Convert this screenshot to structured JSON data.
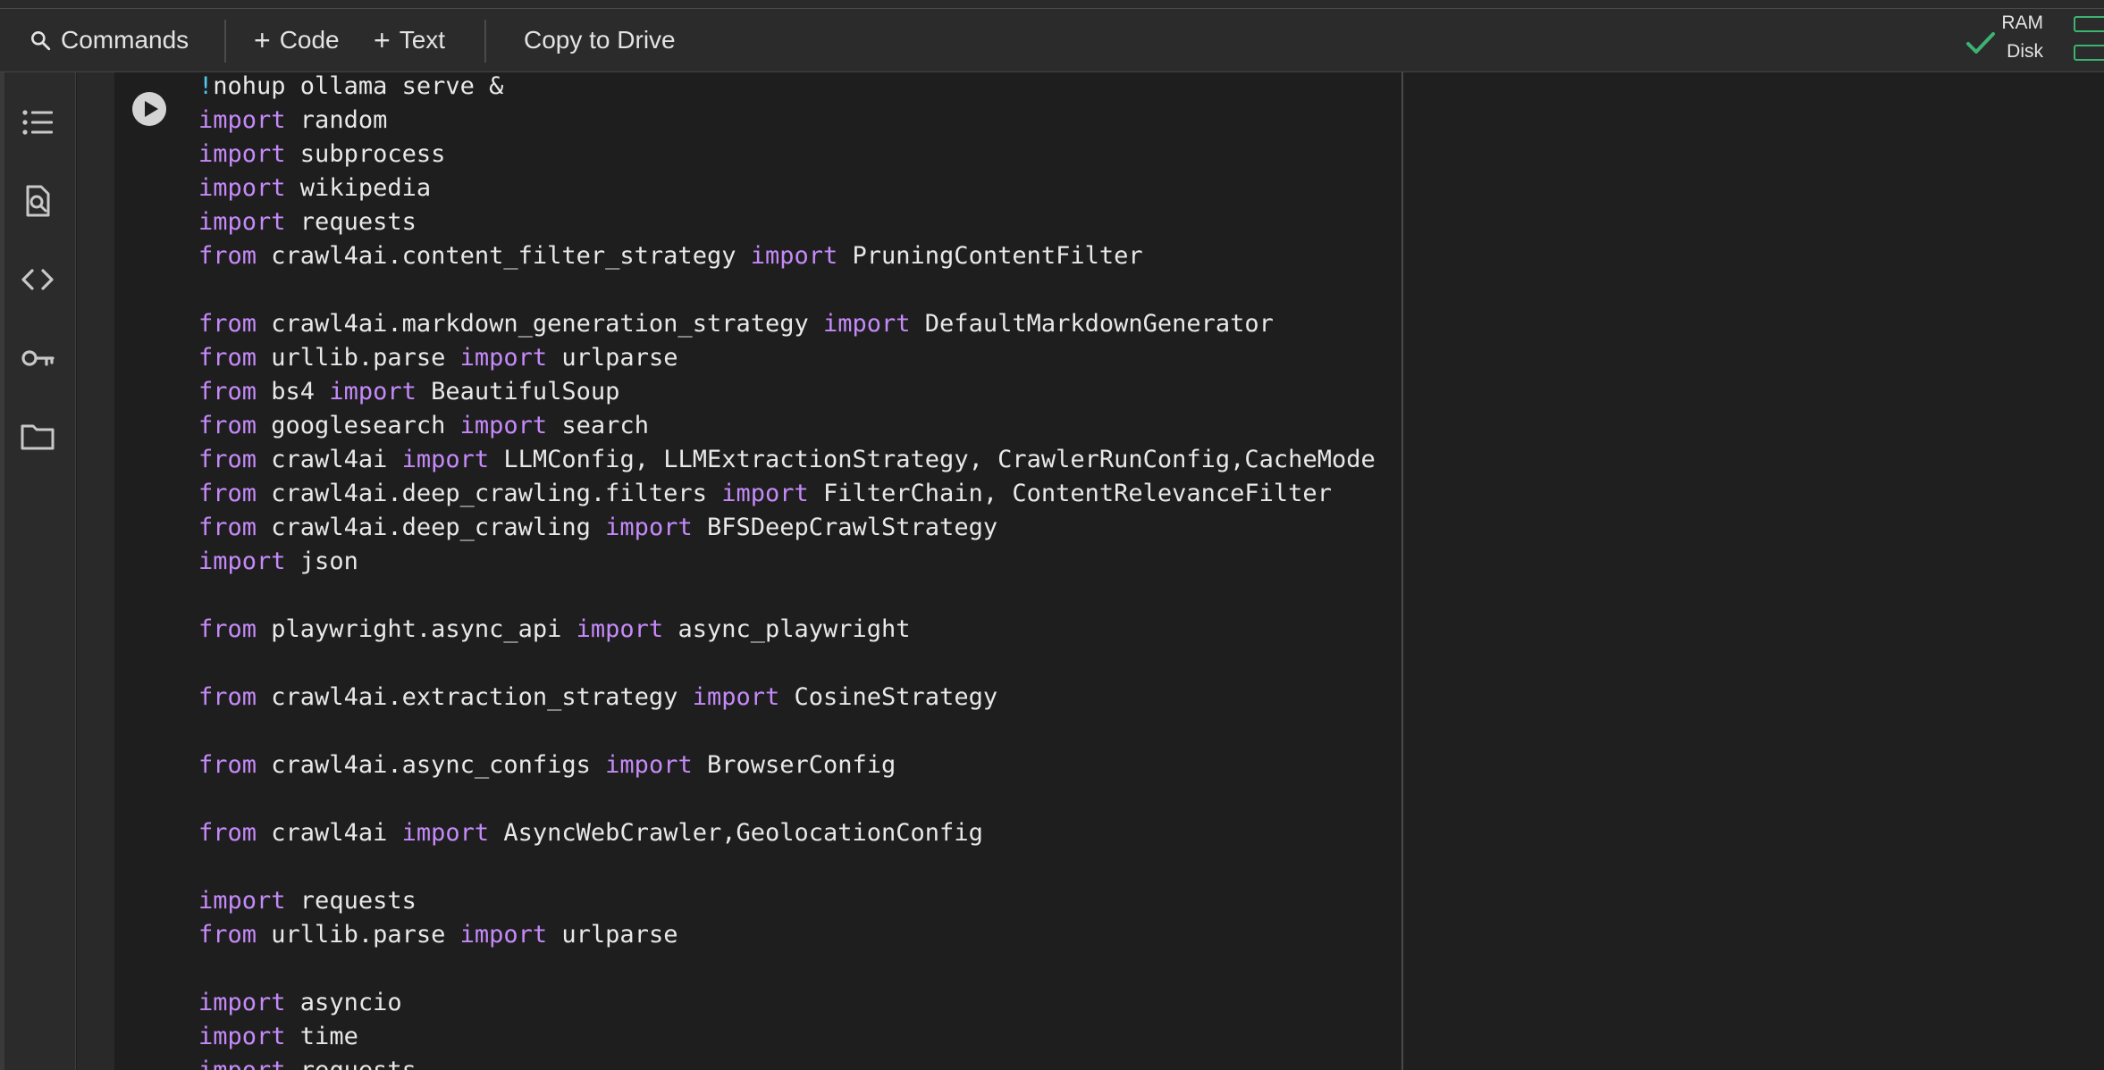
{
  "toolbar": {
    "commands_label": "Commands",
    "code_label": "Code",
    "text_label": "Text",
    "copy_to_drive_label": "Copy to Drive",
    "plus_glyph": "+",
    "ram_label": "RAM",
    "disk_label": "Disk"
  },
  "icons": {
    "search": "search-icon",
    "check": "check-icon",
    "toc": "table-of-contents-icon",
    "find": "find-replace-icon",
    "code": "code-snippets-icon",
    "key": "secrets-key-icon",
    "folder": "files-folder-icon",
    "run": "run-cell-icon"
  },
  "colors": {
    "keyword": "#c58af9",
    "text": "#e8e8e8",
    "shell_bang": "#4ec9f0",
    "status_ok": "#3cb371"
  },
  "code_lines": [
    [
      {
        "t": "!",
        "c": "bang"
      },
      {
        "t": "nohup ollama serve &",
        "c": "plain"
      }
    ],
    [
      {
        "t": "import",
        "c": "kw"
      },
      {
        "t": " random",
        "c": "plain"
      }
    ],
    [
      {
        "t": "import",
        "c": "kw"
      },
      {
        "t": " subprocess",
        "c": "plain"
      }
    ],
    [
      {
        "t": "import",
        "c": "kw"
      },
      {
        "t": " wikipedia",
        "c": "plain"
      }
    ],
    [
      {
        "t": "import",
        "c": "kw"
      },
      {
        "t": " requests",
        "c": "plain"
      }
    ],
    [
      {
        "t": "from",
        "c": "kw"
      },
      {
        "t": " crawl4ai.content_filter_strategy ",
        "c": "plain"
      },
      {
        "t": "import",
        "c": "kw"
      },
      {
        "t": " PruningContentFilter",
        "c": "plain"
      }
    ],
    [],
    [
      {
        "t": "from",
        "c": "kw"
      },
      {
        "t": " crawl4ai.markdown_generation_strategy ",
        "c": "plain"
      },
      {
        "t": "import",
        "c": "kw"
      },
      {
        "t": " DefaultMarkdownGenerator",
        "c": "plain"
      }
    ],
    [
      {
        "t": "from",
        "c": "kw"
      },
      {
        "t": " urllib.parse ",
        "c": "plain"
      },
      {
        "t": "import",
        "c": "kw"
      },
      {
        "t": " urlparse",
        "c": "plain"
      }
    ],
    [
      {
        "t": "from",
        "c": "kw"
      },
      {
        "t": " bs4 ",
        "c": "plain"
      },
      {
        "t": "import",
        "c": "kw"
      },
      {
        "t": " BeautifulSoup",
        "c": "plain"
      }
    ],
    [
      {
        "t": "from",
        "c": "kw"
      },
      {
        "t": " googlesearch ",
        "c": "plain"
      },
      {
        "t": "import",
        "c": "kw"
      },
      {
        "t": " search",
        "c": "plain"
      }
    ],
    [
      {
        "t": "from",
        "c": "kw"
      },
      {
        "t": " crawl4ai ",
        "c": "plain"
      },
      {
        "t": "import",
        "c": "kw"
      },
      {
        "t": " LLMConfig, LLMExtractionStrategy, CrawlerRunConfig,CacheMode",
        "c": "plain"
      }
    ],
    [
      {
        "t": "from",
        "c": "kw"
      },
      {
        "t": " crawl4ai.deep_crawling.filters ",
        "c": "plain"
      },
      {
        "t": "import",
        "c": "kw"
      },
      {
        "t": " FilterChain, ContentRelevanceFilter",
        "c": "plain"
      }
    ],
    [
      {
        "t": "from",
        "c": "kw"
      },
      {
        "t": " crawl4ai.deep_crawling ",
        "c": "plain"
      },
      {
        "t": "import",
        "c": "kw"
      },
      {
        "t": " BFSDeepCrawlStrategy",
        "c": "plain"
      }
    ],
    [
      {
        "t": "import",
        "c": "kw"
      },
      {
        "t": " json",
        "c": "plain"
      }
    ],
    [],
    [
      {
        "t": "from",
        "c": "kw"
      },
      {
        "t": " playwright.async_api ",
        "c": "plain"
      },
      {
        "t": "import",
        "c": "kw"
      },
      {
        "t": " async_playwright",
        "c": "plain"
      }
    ],
    [],
    [
      {
        "t": "from",
        "c": "kw"
      },
      {
        "t": " crawl4ai.extraction_strategy ",
        "c": "plain"
      },
      {
        "t": "import",
        "c": "kw"
      },
      {
        "t": " CosineStrategy",
        "c": "plain"
      }
    ],
    [],
    [
      {
        "t": "from",
        "c": "kw"
      },
      {
        "t": " crawl4ai.async_configs ",
        "c": "plain"
      },
      {
        "t": "import",
        "c": "kw"
      },
      {
        "t": " BrowserConfig",
        "c": "plain"
      }
    ],
    [],
    [
      {
        "t": "from",
        "c": "kw"
      },
      {
        "t": " crawl4ai ",
        "c": "plain"
      },
      {
        "t": "import",
        "c": "kw"
      },
      {
        "t": " AsyncWebCrawler,GeolocationConfig",
        "c": "plain"
      }
    ],
    [],
    [
      {
        "t": "import",
        "c": "kw"
      },
      {
        "t": " requests",
        "c": "plain"
      }
    ],
    [
      {
        "t": "from",
        "c": "kw"
      },
      {
        "t": " urllib.parse ",
        "c": "plain"
      },
      {
        "t": "import",
        "c": "kw"
      },
      {
        "t": " urlparse",
        "c": "plain"
      }
    ],
    [],
    [
      {
        "t": "import",
        "c": "kw"
      },
      {
        "t": " asyncio",
        "c": "plain"
      }
    ],
    [
      {
        "t": "import",
        "c": "kw"
      },
      {
        "t": " time",
        "c": "plain"
      }
    ],
    [
      {
        "t": "import",
        "c": "kw"
      },
      {
        "t": " requests",
        "c": "plain"
      }
    ]
  ]
}
